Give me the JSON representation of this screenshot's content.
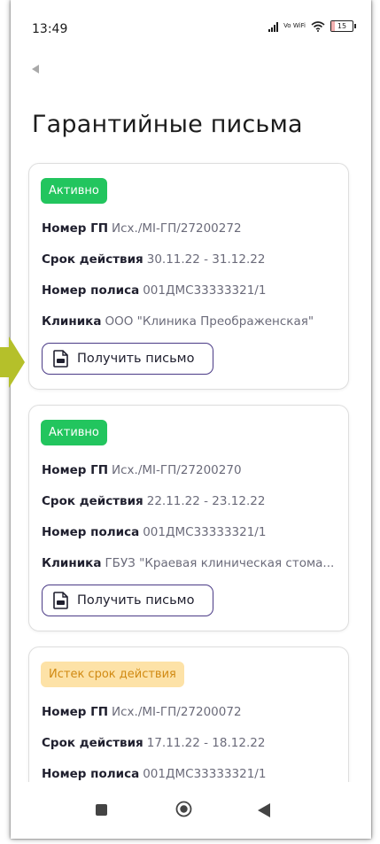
{
  "status_bar": {
    "time": "13:49",
    "network": "Vo WiFi",
    "battery": "15",
    "battery_level": 0.15
  },
  "page": {
    "title": "Гарантийные письма"
  },
  "labels": {
    "gp_number": "Номер ГП",
    "validity": "Срок действия",
    "policy_number": "Номер полиса",
    "clinic": "Клиника",
    "get_letter": "Получить письмо"
  },
  "letters": [
    {
      "status": "Активно",
      "status_type": "active",
      "gp_number": "Исх./MI-ГП/27200272",
      "validity": "30.11.22 - 31.12.22",
      "policy_number": "001ДМС33333321/1",
      "clinic": "ООО \"Клиника Преображенская\""
    },
    {
      "status": "Активно",
      "status_type": "active",
      "gp_number": "Исх./MI-ГП/27200270",
      "validity": "22.11.22 - 23.12.22",
      "policy_number": "001ДМС33333321/1",
      "clinic": "ГБУЗ \"Краевая клиническая стома..."
    },
    {
      "status": "Истек срок действия",
      "status_type": "expired",
      "gp_number": "Исх./MI-ГП/27200072",
      "validity": "17.11.22 - 18.12.22",
      "policy_number": "001ДМС33333321/1"
    }
  ],
  "colors": {
    "active_badge": "#22c55e",
    "expired_badge_bg": "#fde2a7",
    "expired_badge_text": "#d18a13",
    "button_border": "#4a3a86",
    "pointer_arrow": "#b5c02a"
  },
  "icons": {
    "back": "back-arrow-icon",
    "pdf": "pdf-file-icon",
    "nav_recent": "recent-apps-icon",
    "nav_home": "home-icon",
    "nav_back": "nav-back-icon"
  }
}
